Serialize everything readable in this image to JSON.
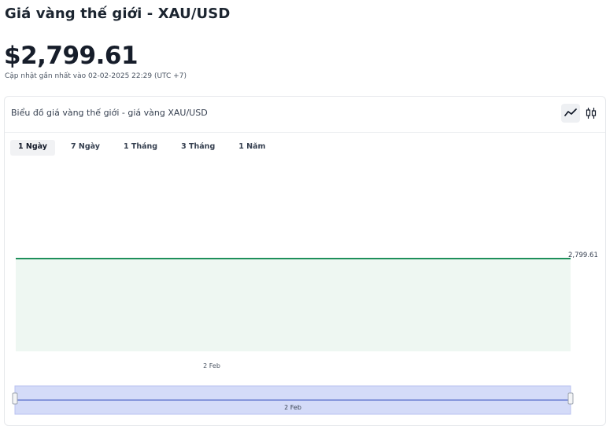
{
  "header": {
    "title": "Giá vàng thế giới - XAU/USD",
    "price": "$2,799.61",
    "updated": "Cập nhật gần nhất vào 02-02-2025 22:29 (UTC +7)"
  },
  "card": {
    "title": "Biểu đồ giá vàng thế giới - giá vàng XAU/USD",
    "toggle": {
      "line_icon": "line-chart-icon",
      "candle_icon": "candlestick-icon",
      "active": "line"
    },
    "tabs": [
      {
        "label": "1 Ngày",
        "active": true
      },
      {
        "label": "7 Ngày",
        "active": false
      },
      {
        "label": "1 Tháng",
        "active": false
      },
      {
        "label": "3 Tháng",
        "active": false
      },
      {
        "label": "1 Năm",
        "active": false
      }
    ]
  },
  "chart_data": {
    "type": "area",
    "x": [
      "2 Feb",
      "2 Feb"
    ],
    "values": [
      2799.61,
      2799.61
    ],
    "x_tick_labels": [
      "2 Feb"
    ],
    "last_value_label": "2,799.61",
    "navigator_label": "2 Feb",
    "colors": {
      "line": "#1e8f5a",
      "fill": "#eef7f2",
      "navigator": "#d4dbf8",
      "navigator_line": "#6d7fd1"
    },
    "grid": false
  }
}
